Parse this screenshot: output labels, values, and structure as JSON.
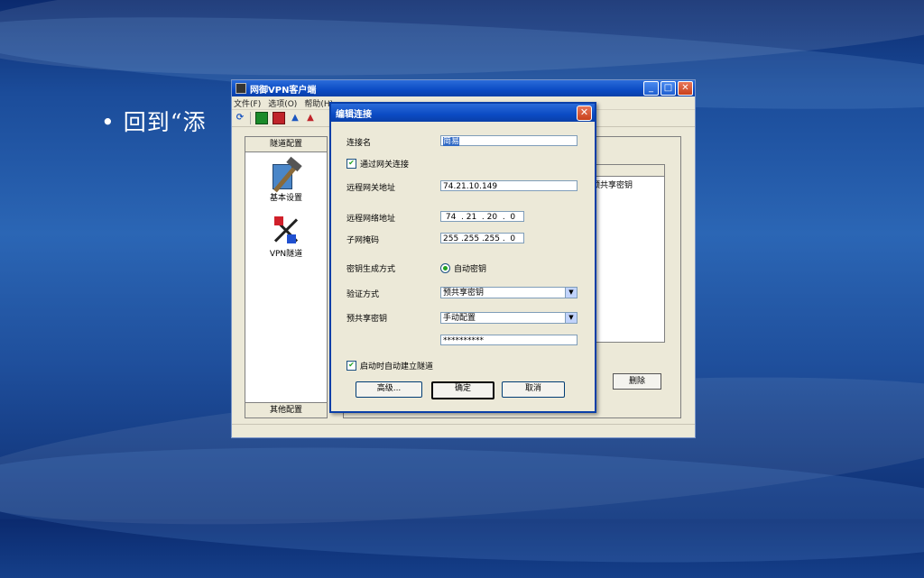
{
  "slide": {
    "bullet_text": "• 回到“添"
  },
  "main_window": {
    "title": "网御VPN客户端",
    "menu": [
      "文件(F)",
      "选项(O)",
      "帮助(H)"
    ],
    "sidebar": {
      "header": "隧道配置",
      "items": [
        {
          "label": "基本设置",
          "icon": "hammer-config-icon"
        },
        {
          "label": "VPN隧道",
          "icon": "vpn-tunnel-icon"
        }
      ],
      "footer": "其他配置"
    },
    "list_header_visible": "预共享密钥",
    "delete_button": "删除"
  },
  "dialog": {
    "title": "编辑连接",
    "fields": {
      "connection_name": {
        "label": "连接名",
        "value": "简易"
      },
      "via_gateway": {
        "label": "通过网关连接",
        "checked": true
      },
      "remote_gateway": {
        "label": "远程网关地址",
        "value": "74.21.10.149"
      },
      "remote_network": {
        "label": "远程网络地址",
        "value": " 74  . 21  . 20  .  0"
      },
      "subnet_mask": {
        "label": "子网掩码",
        "value": "255 .255 .255 .  0"
      },
      "key_generation": {
        "label": "密钥生成方式",
        "option": "自动密钥"
      },
      "auth_method": {
        "label": "验证方式",
        "value": "预共享密钥"
      },
      "preshared_key": {
        "label": "预共享密钥",
        "value": "手动配置",
        "password": "**********"
      },
      "auto_tunnel": {
        "label": "启动时自动建立隧道",
        "checked": true
      }
    },
    "buttons": {
      "advanced": "高级...",
      "ok": "确定",
      "cancel": "取消"
    }
  },
  "colors": {
    "titlebar": "#0b4bc4",
    "window_bg": "#ece9d8",
    "selection": "#316ac5"
  }
}
